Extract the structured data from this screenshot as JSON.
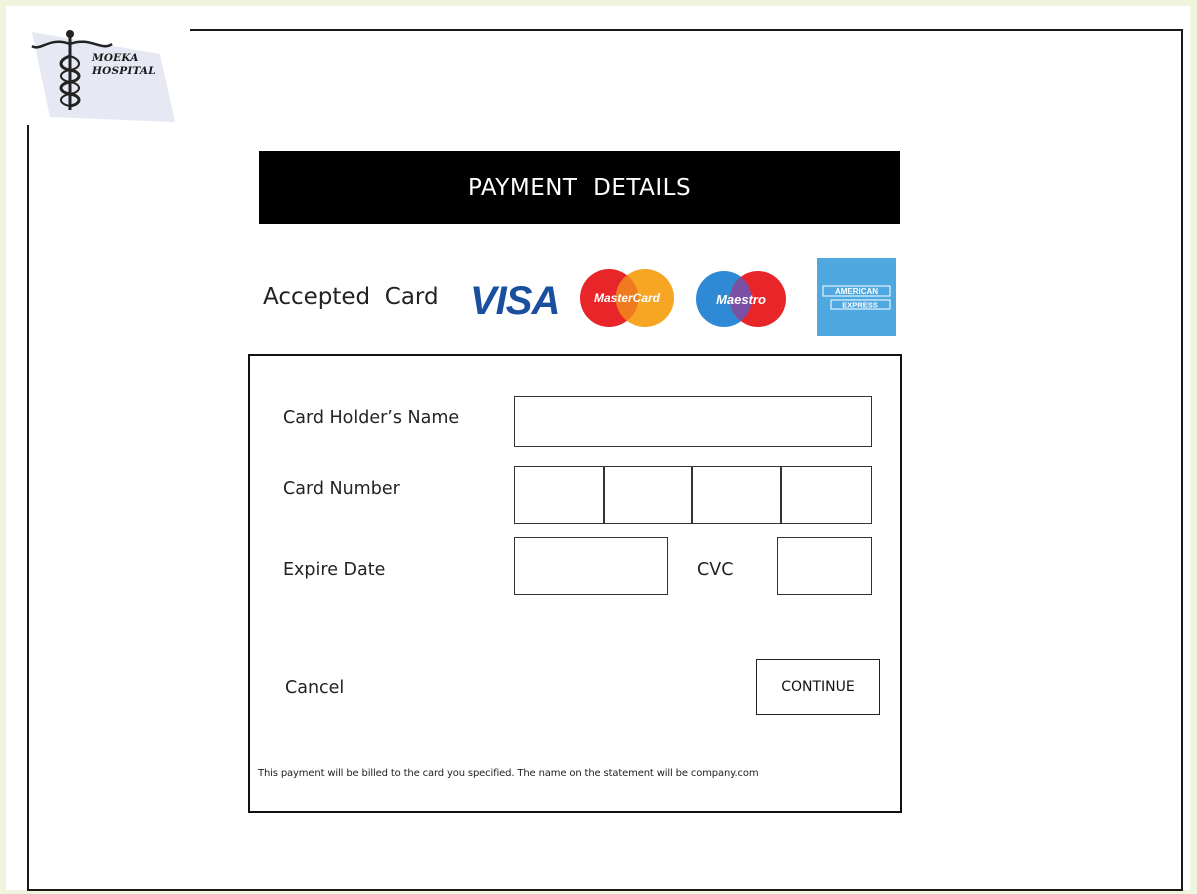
{
  "logo": {
    "line1": "MOEKA",
    "line2": "HOSPITAL"
  },
  "header": {
    "title": "PAYMENT  DETAILS"
  },
  "accepted": {
    "label": "Accepted  Card",
    "cards": [
      {
        "name": "VISA",
        "icon": "visa-icon",
        "color": "#1a4fa0"
      },
      {
        "name": "MasterCard",
        "icon": "mastercard-icon",
        "colors": [
          "#e8262a",
          "#f6a623"
        ]
      },
      {
        "name": "Maestro",
        "icon": "maestro-icon",
        "colors": [
          "#2f8ad6",
          "#e8262a"
        ]
      },
      {
        "name": "AMERICAN EXPRESS",
        "icon": "amex-icon",
        "color": "#4fa8e0"
      }
    ]
  },
  "form": {
    "holder_label": "Card Holder’s Name",
    "number_label": "Card Number",
    "expire_label": "Expire Date",
    "cvc_label": "CVC",
    "cancel_label": "Cancel",
    "continue_label": "CONTINUE",
    "footnote": "This payment will be billed to the card you specified. The name on the statement will be company.com"
  }
}
